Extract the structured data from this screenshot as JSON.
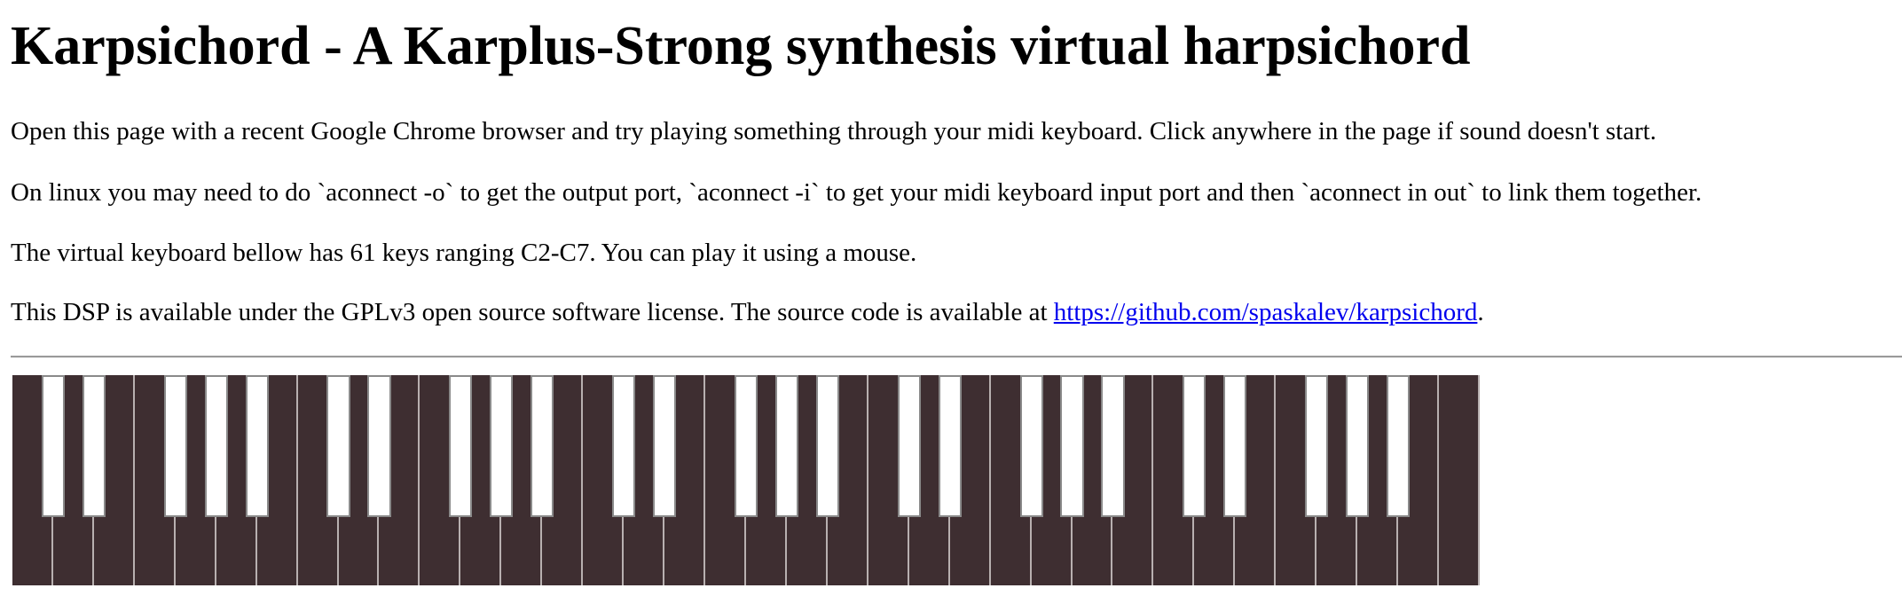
{
  "title": "Karpsichord - A Karplus-Strong synthesis virtual harpsichord",
  "paragraphs": {
    "p1": "Open this page with a recent Google Chrome browser and try playing something through your midi keyboard. Click anywhere in the page if sound doesn't start.",
    "p2": "On linux you may need to do `aconnect -o` to get the output port, `aconnect -i` to get your midi keyboard input port and then `aconnect in out` to link them together.",
    "p3": "The virtual keyboard bellow has 61 keys ranging C2-C7. You can play it using a mouse.",
    "p4_prefix": "This DSP is available under the GPLv3 open source software license. The source code is available at ",
    "p4_link": "https://github.com/spaskalev/karpsichord",
    "p4_suffix": "."
  },
  "keyboard": {
    "range": "C2-C7",
    "key_count": 61,
    "colors": {
      "background": "#3e2e31",
      "sharp_key": "#ffffff",
      "divider": "#b8b0b0"
    }
  }
}
